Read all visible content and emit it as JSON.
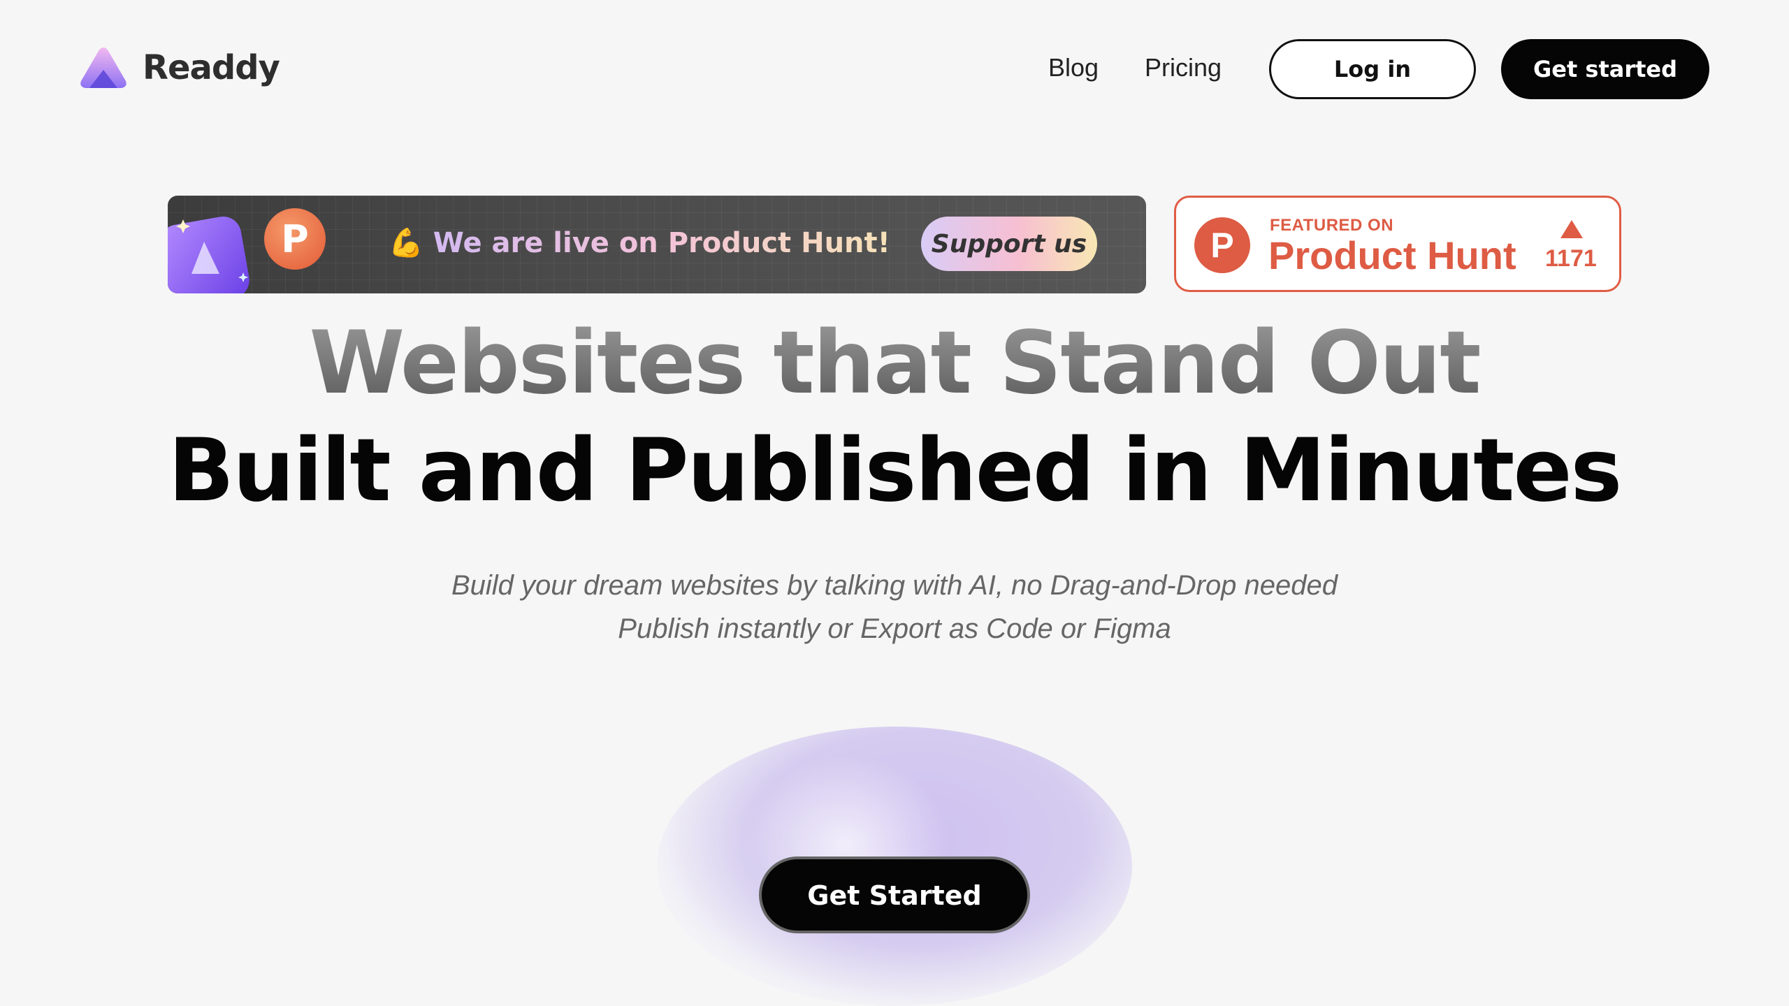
{
  "nav": {
    "brand": "Readdy",
    "links": [
      "Blog",
      "Pricing"
    ],
    "login_label": "Log in",
    "get_started_label": "Get started"
  },
  "live_banner": {
    "emoji": "💪",
    "text": "We are live on Product Hunt!",
    "ph_letter": "P",
    "support_label": "Support us"
  },
  "ph_badge": {
    "featured_label": "FEATURED ON",
    "name": "Product Hunt",
    "letter": "P",
    "upvotes": "1171",
    "color": "#de5b44"
  },
  "hero": {
    "line1": "Websites that Stand Out",
    "line2": "Built and Published in Minutes",
    "sub1": "Build your dream websites by talking with AI, no Drag-and-Drop needed",
    "sub2": "Publish instantly or Export as Code or Figma",
    "cta_label": "Get Started"
  },
  "colors": {
    "background": "#f6f6f6",
    "brand_purple": "#8b6cf0",
    "ph_orange": "#de5b44"
  }
}
